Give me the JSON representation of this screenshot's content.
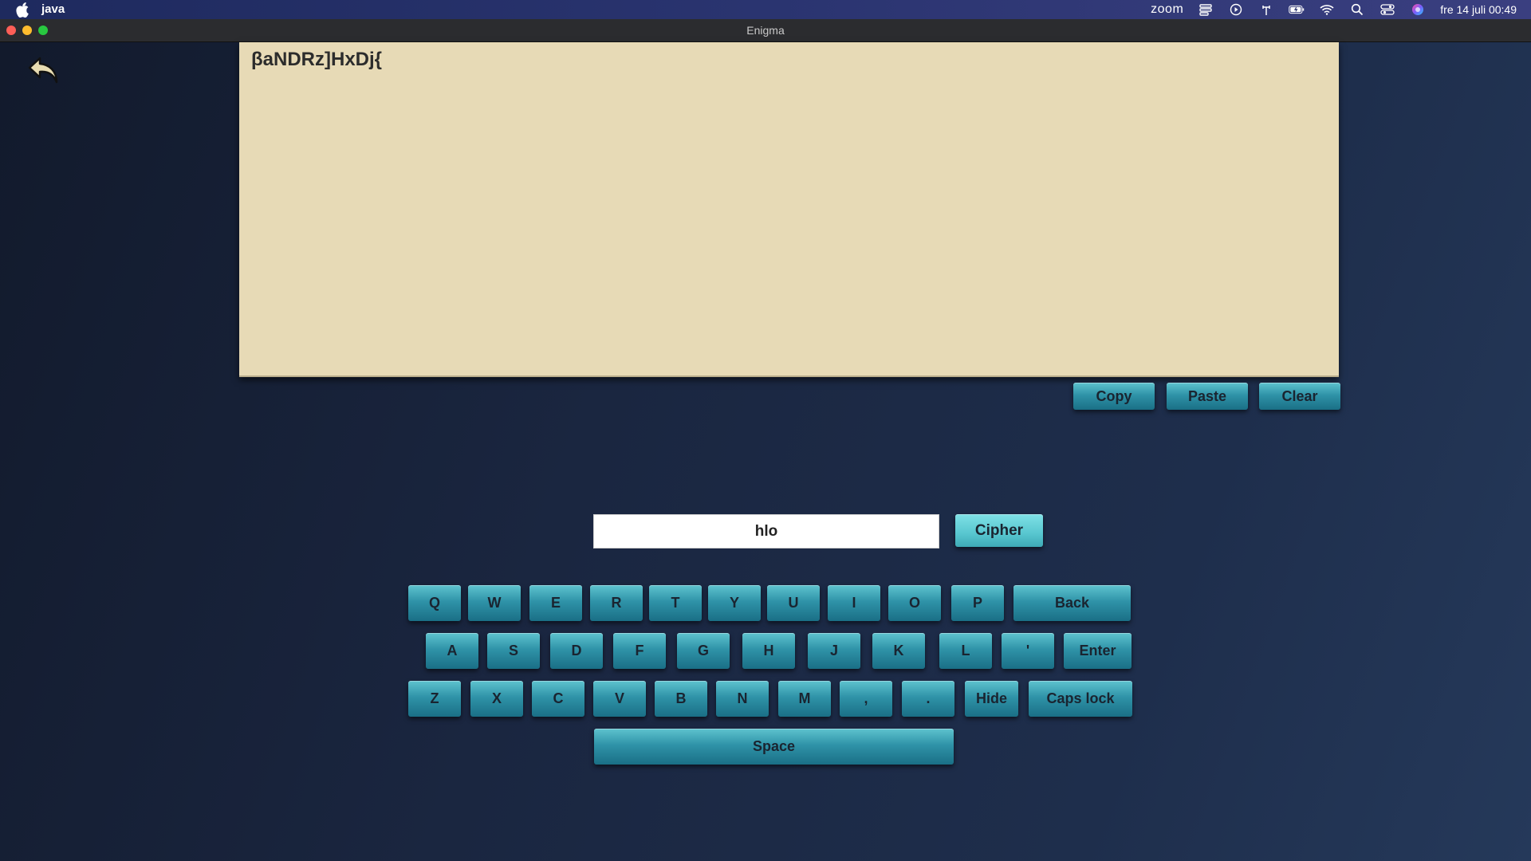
{
  "menubar": {
    "app_name": "java",
    "zoom_label": "zoom",
    "clock": "fre 14 juli 00:49"
  },
  "window": {
    "title": "Enigma"
  },
  "output": {
    "text": "βaNDRz]HxDj{"
  },
  "actions": {
    "copy": "Copy",
    "paste": "Paste",
    "clear": "Clear"
  },
  "input": {
    "value": "hlo"
  },
  "cipher_label": "Cipher",
  "keyboard": {
    "row1": [
      "Q",
      "W",
      "E",
      "R",
      "T",
      "Y",
      "U",
      "I",
      "O",
      "P"
    ],
    "back": "Back",
    "row2": [
      "A",
      "S",
      "D",
      "F",
      "G",
      "H",
      "J",
      "K",
      "L",
      "'"
    ],
    "enter": "Enter",
    "row3": [
      "Z",
      "X",
      "C",
      "V",
      "B",
      "N",
      "M",
      ",",
      "."
    ],
    "hide": "Hide",
    "caps": "Caps lock",
    "space": "Space"
  },
  "colors": {
    "output_bg": "#e7dab6",
    "key_top": "#5ec3cf",
    "key_bottom": "#1a6f86",
    "cipher_bg": "#57c6cf"
  }
}
